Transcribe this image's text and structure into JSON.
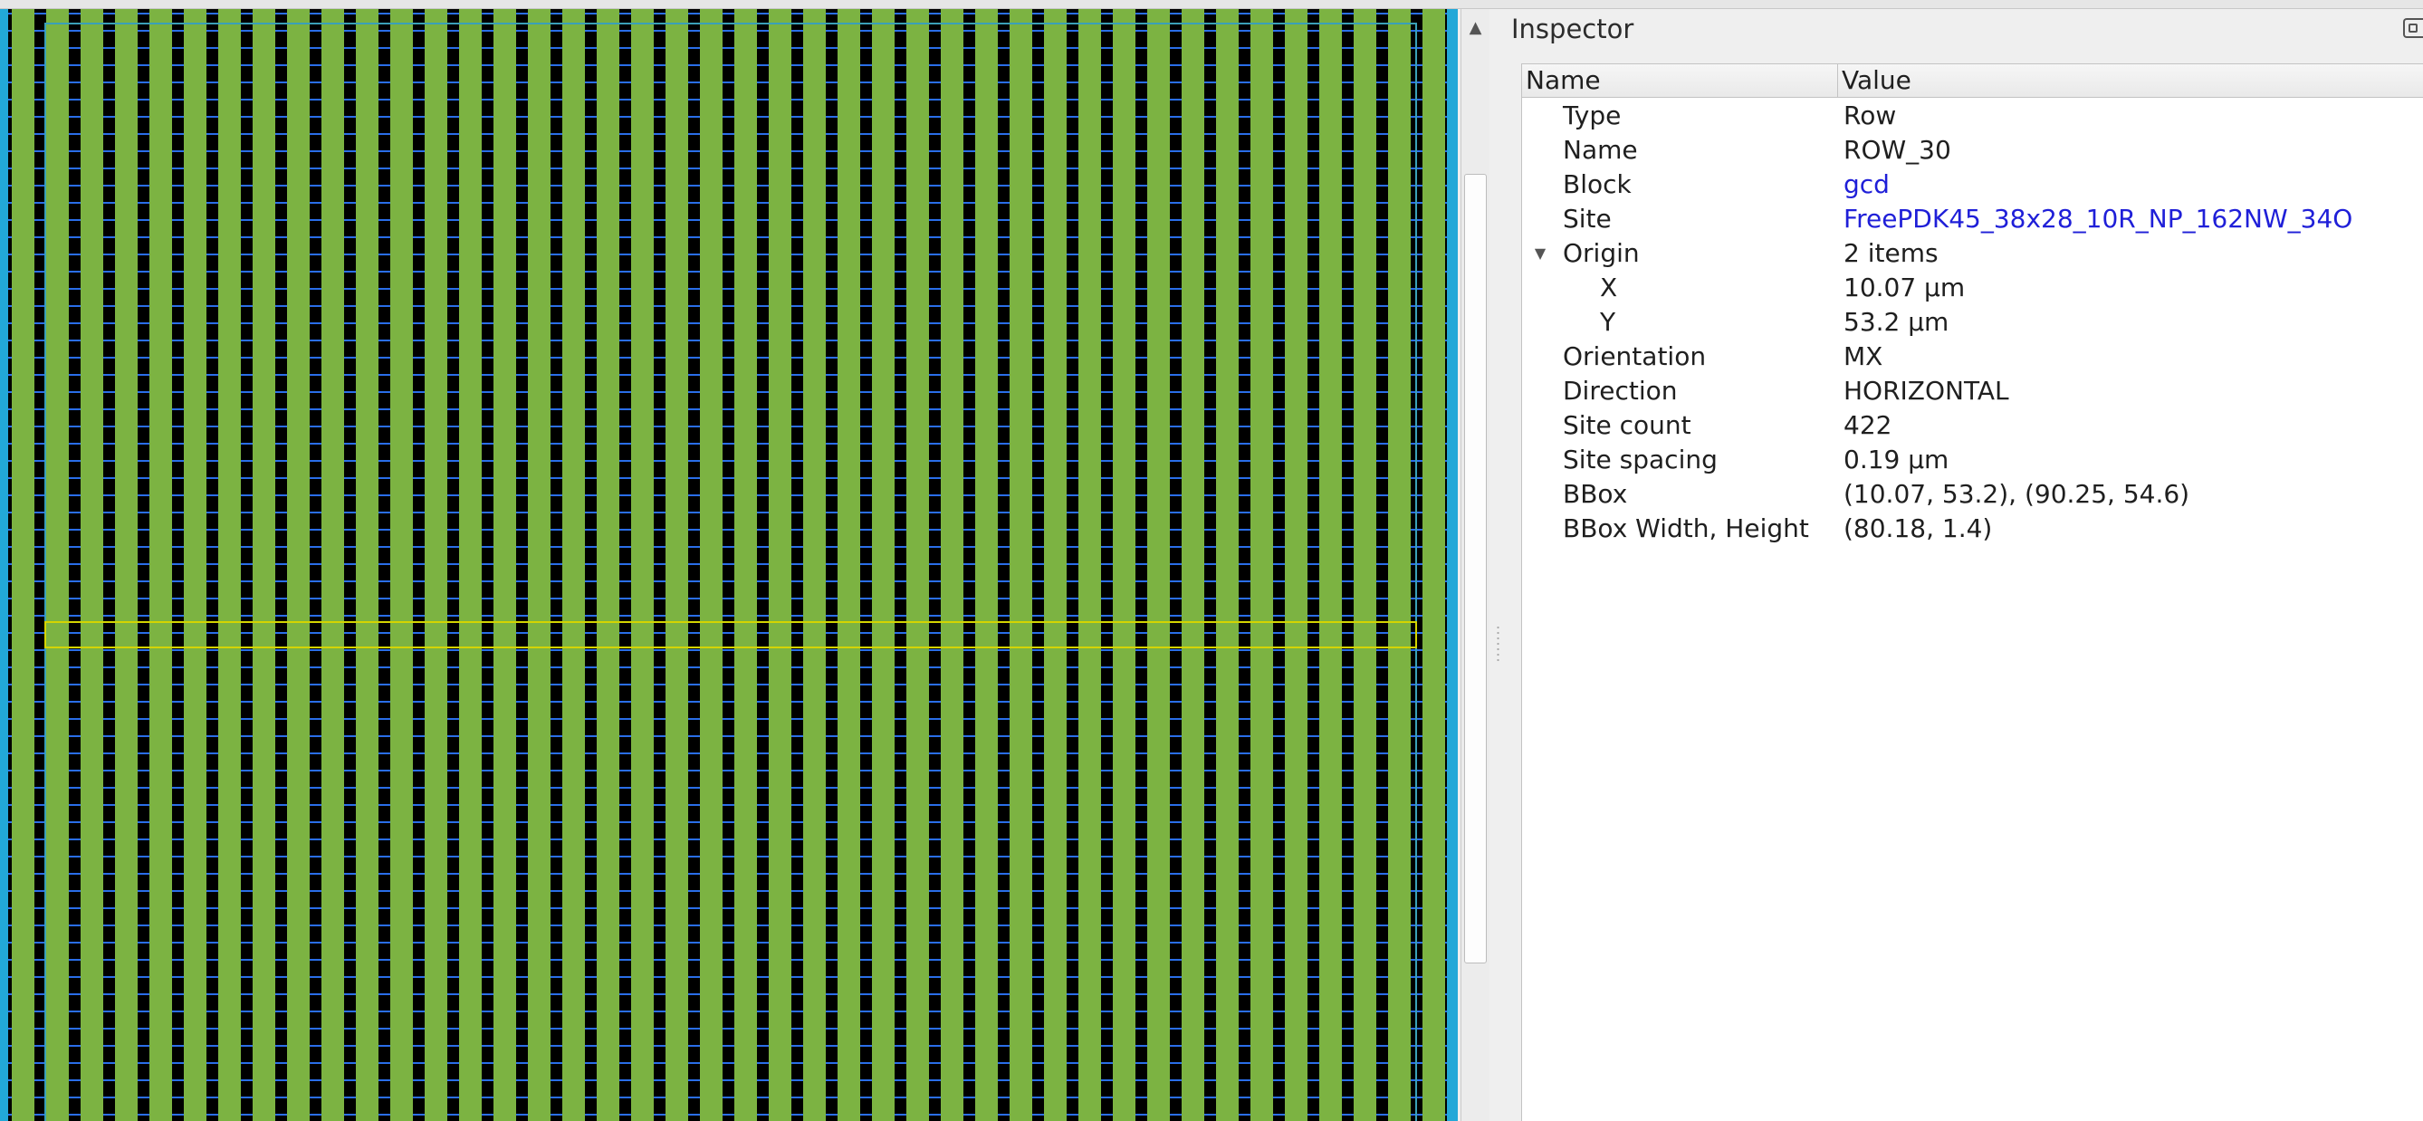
{
  "inspector": {
    "title": "Inspector",
    "columns": {
      "name": "Name",
      "value": "Value"
    },
    "properties": [
      {
        "name": "Type",
        "value": "Row"
      },
      {
        "name": "Name",
        "value": "ROW_30"
      },
      {
        "name": "Block",
        "value": "gcd",
        "link": true
      },
      {
        "name": "Site",
        "value": "FreePDK45_38x28_10R_NP_162NW_34O",
        "link": true
      },
      {
        "name": "Origin",
        "value": "2 items",
        "expanded": true,
        "children": [
          {
            "name": "X",
            "value": "10.07 µm"
          },
          {
            "name": "Y",
            "value": "53.2 µm"
          }
        ]
      },
      {
        "name": "Orientation",
        "value": "MX"
      },
      {
        "name": "Direction",
        "value": "HORIZONTAL"
      },
      {
        "name": "Site count",
        "value": "422"
      },
      {
        "name": "Site spacing",
        "value": "0.19 µm"
      },
      {
        "name": "BBox",
        "value": "(10.07, 53.2), (90.25, 54.6)"
      },
      {
        "name": "BBox Width, Height",
        "value": "(80.18, 1.4)"
      }
    ]
  },
  "colors": {
    "canvas_background": "#000000",
    "stripe_fill": "#7cb342",
    "horizontal_track": "#2a6ee8",
    "edge_track": "#22a8d8",
    "outline": "#3aa0b8",
    "selected_row": "#d4d400",
    "link_text": "#1f1fd8"
  },
  "icons": {
    "scroll_up": "up-arrow-icon",
    "expand": "expanded-triangle-icon",
    "float": "float-window-icon"
  }
}
